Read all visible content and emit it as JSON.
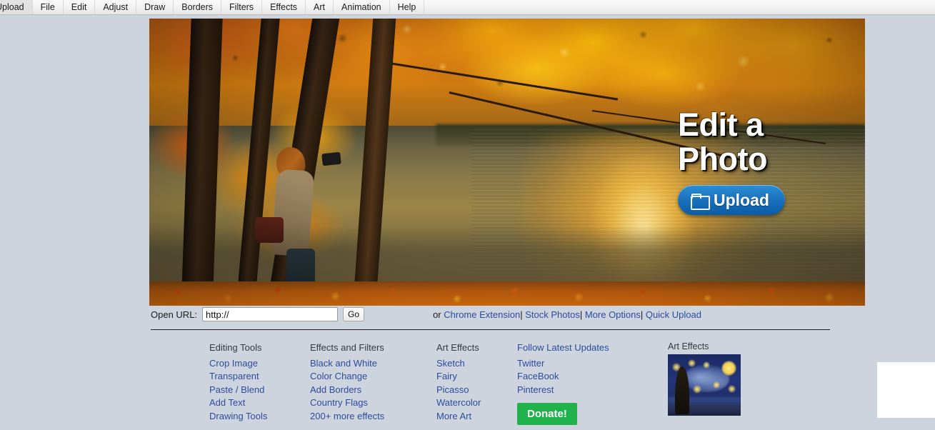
{
  "menubar": {
    "items": [
      {
        "label": "Upload",
        "name": "menu-upload"
      },
      {
        "label": "File",
        "name": "menu-file"
      },
      {
        "label": "Edit",
        "name": "menu-edit"
      },
      {
        "label": "Adjust",
        "name": "menu-adjust"
      },
      {
        "label": "Draw",
        "name": "menu-draw"
      },
      {
        "label": "Borders",
        "name": "menu-borders"
      },
      {
        "label": "Filters",
        "name": "menu-filters"
      },
      {
        "label": "Effects",
        "name": "menu-effects"
      },
      {
        "label": "Art",
        "name": "menu-art"
      },
      {
        "label": "Animation",
        "name": "menu-animation"
      },
      {
        "label": "Help",
        "name": "menu-help"
      }
    ]
  },
  "hero": {
    "title": "Edit a\nPhoto",
    "upload_label": "Upload",
    "upload_icon": "folder-icon",
    "photo_alt": "Autumn trees by a lake with a photographer",
    "accent_blue": "#1a72bd"
  },
  "url_row": {
    "label": "Open URL:",
    "input_value": "http://",
    "input_placeholder": "http://",
    "go_label": "Go",
    "or_label": "or",
    "links": [
      {
        "label": "Chrome Extension",
        "name": "link-chrome-extension"
      },
      {
        "label": "Stock Photos",
        "name": "link-stock-photos"
      },
      {
        "label": "More Options",
        "name": "link-more-options"
      },
      {
        "label": "Quick Upload",
        "name": "link-quick-upload"
      }
    ],
    "separator": "|"
  },
  "footer": {
    "columns": [
      {
        "heading": "Editing Tools",
        "heading_is_link": false,
        "links": [
          {
            "label": "Crop Image"
          },
          {
            "label": "Transparent"
          },
          {
            "label": "Paste / Blend"
          },
          {
            "label": "Add Text"
          },
          {
            "label": "Drawing Tools"
          }
        ]
      },
      {
        "heading": "Effects and Filters",
        "heading_is_link": false,
        "links": [
          {
            "label": "Black and White"
          },
          {
            "label": "Color Change"
          },
          {
            "label": "Add Borders"
          },
          {
            "label": "Country Flags"
          },
          {
            "label": "200+ more effects"
          }
        ]
      },
      {
        "heading": "Art Effects",
        "heading_is_link": false,
        "links": [
          {
            "label": "Sketch"
          },
          {
            "label": "Fairy"
          },
          {
            "label": "Picasso"
          },
          {
            "label": "Watercolor"
          },
          {
            "label": "More Art"
          }
        ]
      },
      {
        "heading": "Follow Latest Updates",
        "heading_is_link": true,
        "links": [
          {
            "label": "Twitter"
          },
          {
            "label": "FaceBook"
          },
          {
            "label": "Pinterest"
          }
        ]
      }
    ],
    "donate_label": "Donate!",
    "donate_color": "#22b24c"
  },
  "art_thumb": {
    "label": "Art Effects",
    "image_alt": "Starry Night painting thumbnail"
  },
  "theme": {
    "background": "#cdd4de",
    "link_color": "#2b4b9e",
    "heading_color": "#333a3f"
  }
}
